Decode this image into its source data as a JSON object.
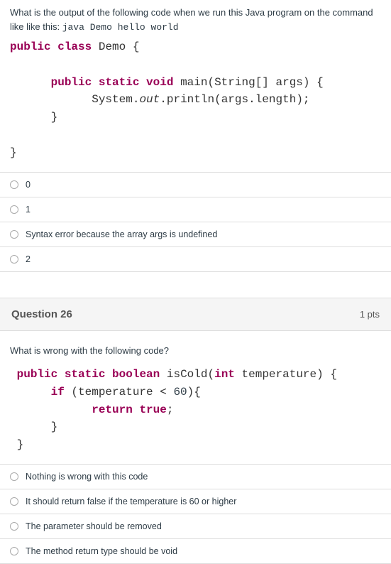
{
  "q25": {
    "prompt_pre": "What is the output of the following code when we run this Java program on the command like like this: ",
    "prompt_cmd": "java Demo hello world",
    "code_tokens": [
      {
        "t": "public",
        "c": "kw"
      },
      {
        "t": " ",
        "c": ""
      },
      {
        "t": "class",
        "c": "kw"
      },
      {
        "t": " ",
        "c": ""
      },
      {
        "t": "Demo",
        "c": "id"
      },
      {
        "t": " {",
        "c": "punct"
      },
      {
        "t": "\n\n",
        "c": ""
      },
      {
        "t": "      ",
        "c": ""
      },
      {
        "t": "public",
        "c": "kw"
      },
      {
        "t": " ",
        "c": ""
      },
      {
        "t": "static",
        "c": "kw"
      },
      {
        "t": " ",
        "c": ""
      },
      {
        "t": "void",
        "c": "kw"
      },
      {
        "t": " ",
        "c": ""
      },
      {
        "t": "main",
        "c": "id"
      },
      {
        "t": "(",
        "c": "punct"
      },
      {
        "t": "String",
        "c": "id"
      },
      {
        "t": "[] ",
        "c": "punct"
      },
      {
        "t": "args",
        "c": "id"
      },
      {
        "t": ") {",
        "c": "punct"
      },
      {
        "t": "\n",
        "c": ""
      },
      {
        "t": "            ",
        "c": ""
      },
      {
        "t": "System",
        "c": "id"
      },
      {
        "t": ".",
        "c": "punct"
      },
      {
        "t": "out",
        "c": "it"
      },
      {
        "t": ".",
        "c": "punct"
      },
      {
        "t": "println",
        "c": "id"
      },
      {
        "t": "(",
        "c": "punct"
      },
      {
        "t": "args",
        "c": "id"
      },
      {
        "t": ".",
        "c": "punct"
      },
      {
        "t": "length",
        "c": "id"
      },
      {
        "t": ");",
        "c": "punct"
      },
      {
        "t": "\n",
        "c": ""
      },
      {
        "t": "      }",
        "c": "punct"
      },
      {
        "t": "\n\n",
        "c": ""
      },
      {
        "t": "}",
        "c": "punct"
      }
    ],
    "options": [
      "0",
      "1",
      "Syntax error because the array args is undefined",
      "2"
    ]
  },
  "q26": {
    "header": "Question 26",
    "points": "1 pts",
    "prompt": "What is wrong with the following code?",
    "code_tokens": [
      {
        "t": " ",
        "c": ""
      },
      {
        "t": "public",
        "c": "kw"
      },
      {
        "t": " ",
        "c": ""
      },
      {
        "t": "static",
        "c": "kw"
      },
      {
        "t": " ",
        "c": ""
      },
      {
        "t": "boolean",
        "c": "kw"
      },
      {
        "t": " ",
        "c": ""
      },
      {
        "t": "isCold",
        "c": "id"
      },
      {
        "t": "(",
        "c": "punct"
      },
      {
        "t": "int",
        "c": "kw"
      },
      {
        "t": " ",
        "c": ""
      },
      {
        "t": "temperature",
        "c": "id"
      },
      {
        "t": ") {",
        "c": "punct"
      },
      {
        "t": "\n",
        "c": ""
      },
      {
        "t": "      ",
        "c": ""
      },
      {
        "t": "if",
        "c": "kw"
      },
      {
        "t": " (",
        "c": "punct"
      },
      {
        "t": "temperature",
        "c": "id"
      },
      {
        "t": " < ",
        "c": "punct"
      },
      {
        "t": "60",
        "c": "num"
      },
      {
        "t": "){",
        "c": "punct"
      },
      {
        "t": "\n",
        "c": ""
      },
      {
        "t": "            ",
        "c": ""
      },
      {
        "t": "return",
        "c": "kw"
      },
      {
        "t": " ",
        "c": ""
      },
      {
        "t": "true",
        "c": "kw"
      },
      {
        "t": ";",
        "c": "punct"
      },
      {
        "t": "\n",
        "c": ""
      },
      {
        "t": "      }",
        "c": "punct"
      },
      {
        "t": "\n",
        "c": ""
      },
      {
        "t": " }",
        "c": "punct"
      }
    ],
    "options": [
      "Nothing is wrong with this code",
      "It should return false if the temperature is 60 or higher",
      "The parameter should be removed",
      "The method return type should be void"
    ]
  }
}
